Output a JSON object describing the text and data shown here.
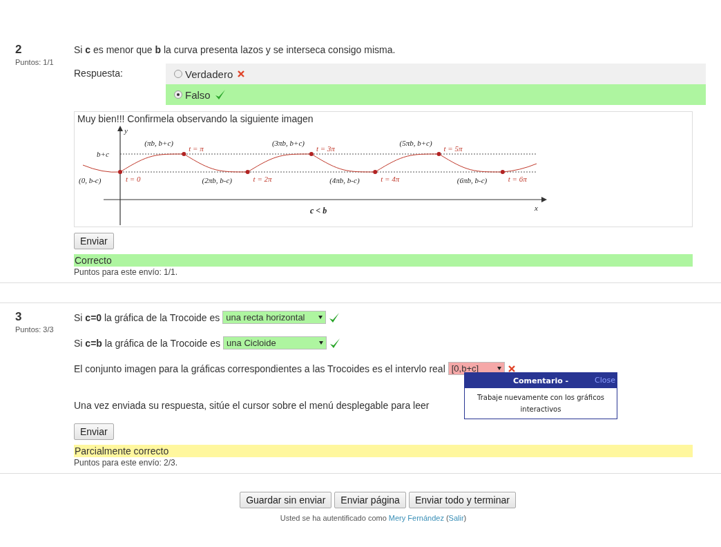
{
  "questions": [
    {
      "number": "2",
      "points": "Puntos: 1/1",
      "kind": "truefalse",
      "text": "Si **c** es menor que **b** la curva presenta lazos y se interseca consigo misma.",
      "answer_label": "Respuesta:",
      "options": [
        {
          "label": "Verdadero",
          "selected": false,
          "correct": false
        },
        {
          "label": "Falso",
          "selected": true,
          "correct": true
        }
      ],
      "feedback": {
        "text": "Muy bien!!! Confirmela observando la siguiente imagen",
        "figure": {
          "axis_y": "y",
          "axis_x": "x",
          "level_label": "b+c",
          "caption": "c < b",
          "points": [
            {
              "coord": "(0, b-c)",
              "t": "t = 0"
            },
            {
              "coord": "(πb, b+c)",
              "t": "t = π"
            },
            {
              "coord": "(2πb, b-c)",
              "t": "t = 2π"
            },
            {
              "coord": "(3πb, b+c)",
              "t": "t = 3π"
            },
            {
              "coord": "(4πb, b-c)",
              "t": "t = 4π"
            },
            {
              "coord": "(5πb, b+c)",
              "t": "t = 5π"
            },
            {
              "coord": "(6πb, b-c)",
              "t": "t = 6π"
            }
          ]
        }
      },
      "submit": "Enviar",
      "grade": {
        "kind": "correct",
        "label": "Correcto"
      },
      "score": "Puntos para este envío: 1/1."
    },
    {
      "number": "3",
      "points": "Puntos: 3/3",
      "kind": "dropdowns",
      "lines": [
        {
          "text": "Si **c=0** la gráfica de la Trocoide es",
          "select": {
            "value": "una recta horizontal",
            "correct": true
          }
        },
        {
          "text": "Si **c=b** la gráfica de la Trocoide es",
          "select": {
            "value": "una Cicloide",
            "correct": true
          }
        },
        {
          "text": "El conjunto imagen para la gráficas correspondientes a las Trocoides es el intervlo real",
          "select": {
            "value": "[0,b+c]",
            "correct": false
          }
        },
        {
          "text": "Una vez enviada su respuesta, sitúe el cursor sobre el menú desplegable para leer"
        }
      ],
      "popup": {
        "title": "Comentario -",
        "close": "Close",
        "body": "Trabaje nuevamente con los gráficos interactivos"
      },
      "submit": "Enviar",
      "grade": {
        "kind": "partial",
        "label": "Parcialmente correcto"
      },
      "score": "Puntos para este envío: 2/3."
    }
  ],
  "buttons": [
    "Guardar sin enviar",
    "Enviar página",
    "Enviar todo y terminar"
  ],
  "login": {
    "prefix": "Usted se ha autentificado como",
    "user": "Mery Fernández",
    "open": "(",
    "logout": "Salir",
    "close": ")"
  }
}
